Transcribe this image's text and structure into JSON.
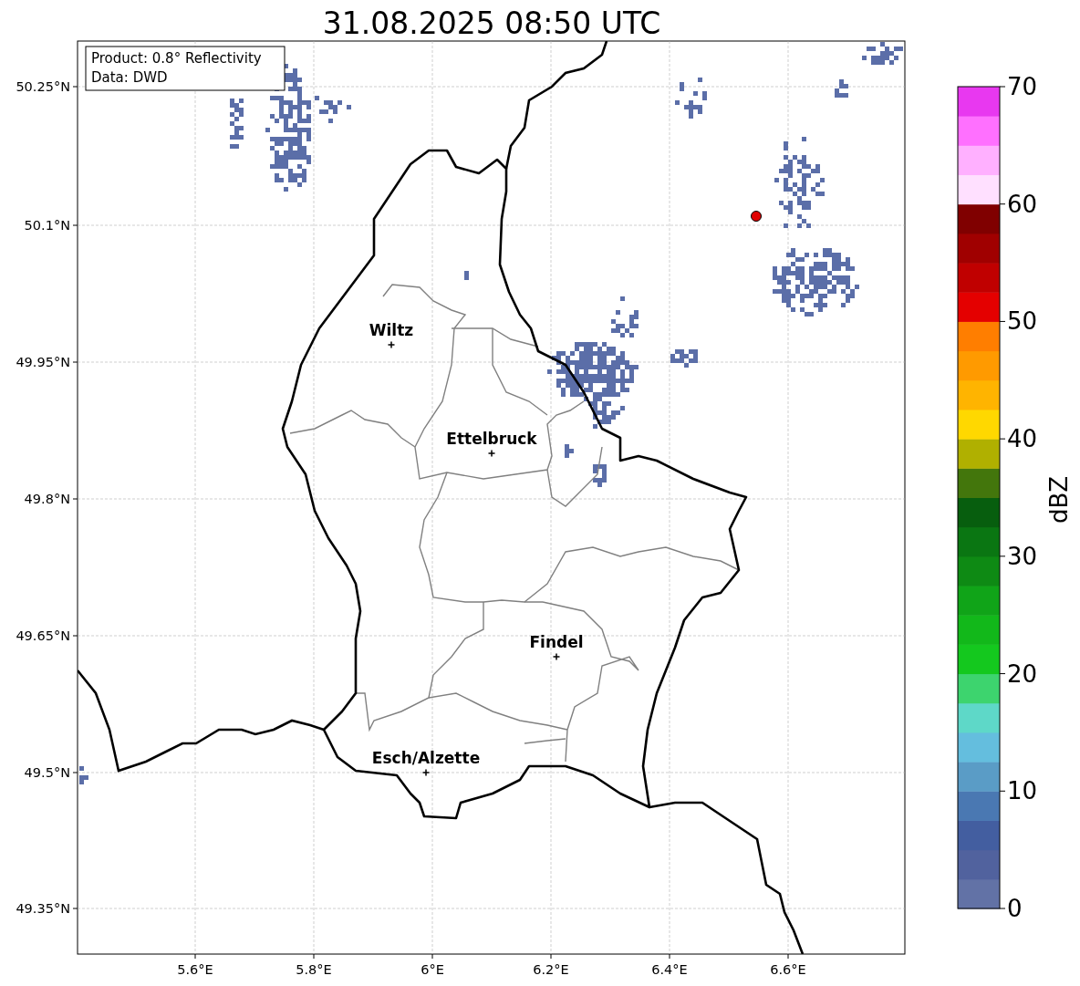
{
  "title": "31.08.2025 08:50 UTC",
  "info_box": [
    "Product: 0.8° Reflectivity",
    "Data: DWD"
  ],
  "y_ticks": [
    "50.25°N",
    "50.1°N",
    "49.95°N",
    "49.8°N",
    "49.65°N",
    "49.5°N",
    "49.35°N"
  ],
  "x_ticks": [
    "5.6°E",
    "5.8°E",
    "6°E",
    "6.2°E",
    "6.4°E",
    "6.6°E"
  ],
  "cities": [
    {
      "name": "Wiltz"
    },
    {
      "name": "Ettelbruck"
    },
    {
      "name": "Findel"
    },
    {
      "name": "Esch/Alzette"
    }
  ],
  "colorbar": {
    "label": "dBZ",
    "ticks": [
      "70",
      "60",
      "50",
      "40",
      "30",
      "20",
      "10",
      "0"
    ],
    "bins": [
      {
        "color": "#6272a6"
      },
      {
        "color": "#51629e"
      },
      {
        "color": "#435ea0"
      },
      {
        "color": "#4a78b2"
      },
      {
        "color": "#5a9cc6"
      },
      {
        "color": "#64bede"
      },
      {
        "color": "#5ed8c8"
      },
      {
        "color": "#3dd46e"
      },
      {
        "color": "#14c81e"
      },
      {
        "color": "#12b81a"
      },
      {
        "color": "#10a418"
      },
      {
        "color": "#0e8a14"
      },
      {
        "color": "#0a7612"
      },
      {
        "color": "#075e0e"
      },
      {
        "color": "#43760c"
      },
      {
        "color": "#b0b000"
      },
      {
        "color": "#ffd800"
      },
      {
        "color": "#ffb400"
      },
      {
        "color": "#ff9a00"
      },
      {
        "color": "#ff7e00"
      },
      {
        "color": "#e40000"
      },
      {
        "color": "#c00000"
      },
      {
        "color": "#a00000"
      },
      {
        "color": "#800000"
      },
      {
        "color": "#ffe0ff"
      },
      {
        "color": "#ffb0ff"
      },
      {
        "color": "#ff70ff"
      },
      {
        "color": "#e838f0"
      }
    ]
  }
}
